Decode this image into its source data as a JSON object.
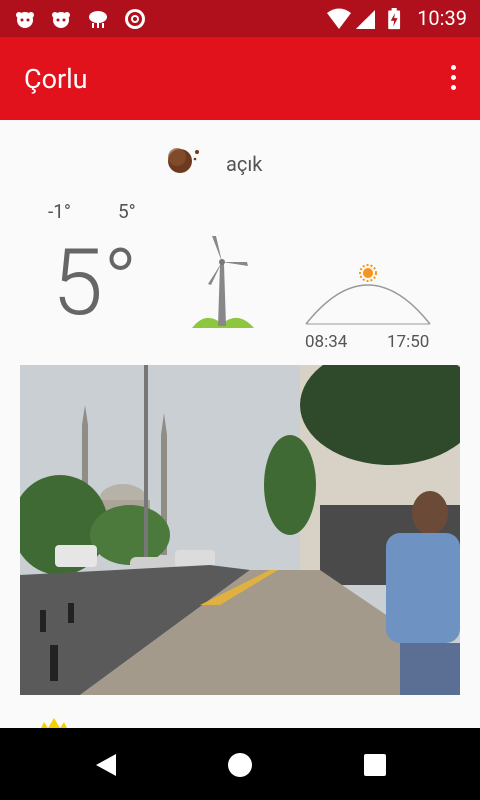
{
  "status_bar": {
    "time": "10:39"
  },
  "app_bar": {
    "title": "Çorlu"
  },
  "weather": {
    "condition": "açık",
    "low": "-1°",
    "high": "5°",
    "current_temp": "5°",
    "sunrise": "08:34",
    "sunset": "17:50"
  },
  "colors": {
    "status_bar": "#b0101b",
    "app_bar": "#e2121c",
    "accent_green": "#8dc63f",
    "sun": "#f7941d"
  }
}
